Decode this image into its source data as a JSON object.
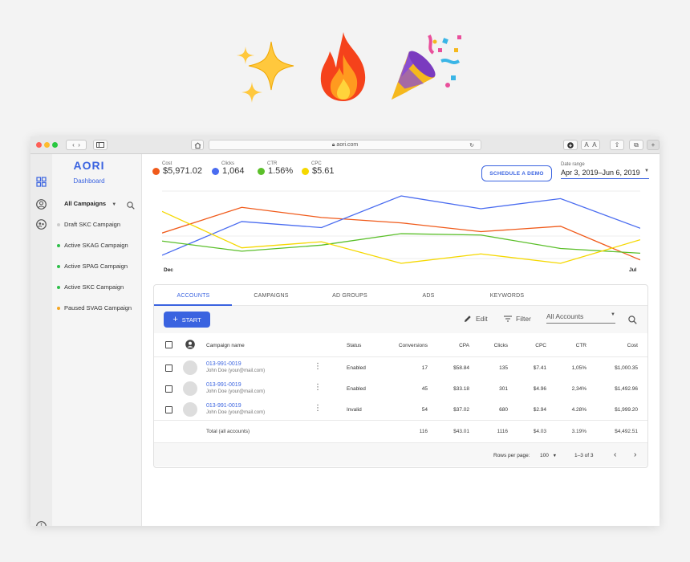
{
  "browser": {
    "url": "aori.com",
    "text_size_small": "A",
    "text_size_large": "A"
  },
  "sidebar": {
    "logo": "AORI",
    "dashboard_link": "Dashboard",
    "filter_label": "All Campaigns",
    "items": [
      {
        "label": "Draft SKC Campaign",
        "color": "#cccccc"
      },
      {
        "label": "Active SKAG Campaign",
        "color": "#2fbf4a"
      },
      {
        "label": "Active SPAG Campaign",
        "color": "#2fbf4a"
      },
      {
        "label": "Active SKC Campaign",
        "color": "#2fbf4a"
      },
      {
        "label": "Paused SVAG Campaign",
        "color": "#f5a623"
      }
    ]
  },
  "metrics": [
    {
      "label": "Cost",
      "value": "$5,971.02",
      "color": "#f05a1a"
    },
    {
      "label": "Clicks",
      "value": "1,064",
      "color": "#4a6cf0"
    },
    {
      "label": "CTR",
      "value": "1.56%",
      "color": "#5bbf2a"
    },
    {
      "label": "CPC",
      "value": "$5.61",
      "color": "#f5d800"
    }
  ],
  "header": {
    "demo_button": "SCHEDULE A DEMO",
    "date_range_label": "Date range",
    "date_range_value": "Apr 3, 2019–Jun 6, 2019"
  },
  "chart_data": {
    "type": "line",
    "x_start_label": "Dec",
    "x_end_label": "Jul",
    "x": [
      0,
      1,
      2,
      3,
      4,
      5,
      6
    ],
    "series": [
      {
        "name": "Cost",
        "color": "#f05a1a",
        "values": [
          0.45,
          0.83,
          0.68,
          0.6,
          0.47,
          0.55,
          0.05
        ]
      },
      {
        "name": "Clicks",
        "color": "#4a6cf0",
        "values": [
          0.12,
          0.62,
          0.53,
          1.0,
          0.81,
          0.96,
          0.52
        ]
      },
      {
        "name": "CTR",
        "color": "#5bbf2a",
        "values": [
          0.33,
          0.18,
          0.27,
          0.44,
          0.42,
          0.22,
          0.15
        ]
      },
      {
        "name": "CPC",
        "color": "#f5d800",
        "values": [
          0.77,
          0.23,
          0.32,
          0.0,
          0.14,
          0.0,
          0.35
        ]
      }
    ]
  },
  "tabs": [
    "ACCOUNTS",
    "CAMPAIGNS",
    "AD GROUPS",
    "ADS",
    "KEYWORDS"
  ],
  "toolbar": {
    "start_label": "START",
    "edit_label": "Edit",
    "filter_label": "Filter",
    "account_select": "All Accounts"
  },
  "table": {
    "headers": {
      "name": "Campaign name",
      "status": "Status",
      "conversions": "Conversions",
      "cpa": "CPA",
      "clicks": "Clicks",
      "cpc": "CPC",
      "ctr": "CTR",
      "cost": "Cost"
    },
    "rows": [
      {
        "name": "013-991-0019",
        "owner": "John Doe (your@mail.com)",
        "status": "Enabled",
        "conversions": "17",
        "cpa": "$58.84",
        "clicks": "135",
        "cpc": "$7.41",
        "ctr": "1,05%",
        "cost": "$1,000.35"
      },
      {
        "name": "013-991-0019",
        "owner": "John Doe (your@mail.com)",
        "status": "Enabled",
        "conversions": "45",
        "cpa": "$33.18",
        "clicks": "301",
        "cpc": "$4.96",
        "ctr": "2,34%",
        "cost": "$1,492.96"
      },
      {
        "name": "013-991-0019",
        "owner": "John Doe (your@mail.com)",
        "status": "Invalid",
        "conversions": "54",
        "cpa": "$37.02",
        "clicks": "680",
        "cpc": "$2.94",
        "ctr": "4.28%",
        "cost": "$1,999.20"
      }
    ],
    "total": {
      "label": "Total (all accounts)",
      "conversions": "116",
      "cpa": "$43.01",
      "clicks": "1116",
      "cpc": "$4.03",
      "ctr": "3.19%",
      "cost": "$4,492.51"
    }
  },
  "pagination": {
    "rows_per_page_label": "Rows per page:",
    "rows_per_page_value": "100",
    "range": "1–3 of 3"
  }
}
